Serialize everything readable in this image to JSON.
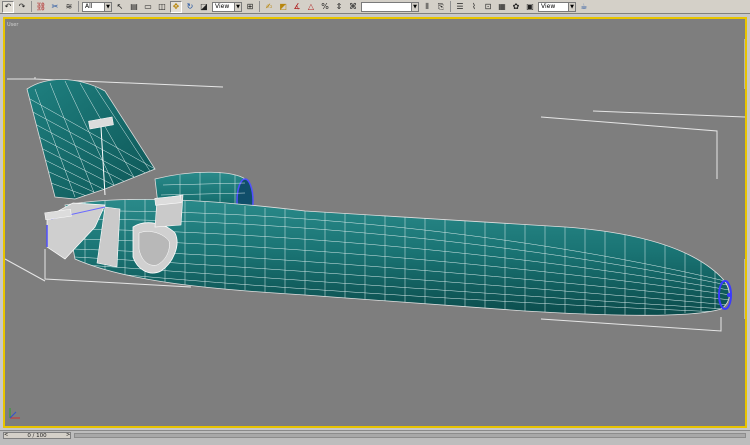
{
  "toolbar": {
    "selection_filter": "All",
    "reference_coord_1": "View",
    "reference_coord_2": "View",
    "named_selection": "",
    "icons": [
      "undo-icon",
      "redo-icon",
      "select-and-link-icon",
      "unlink-icon",
      "bind-spacewarp-icon",
      "select-object-icon",
      "select-by-name-icon",
      "rect-selection-icon",
      "window-crossing-icon",
      "select-move-icon",
      "select-rotate-icon",
      "select-scale-icon",
      "pivot-icon",
      "snap-toggle-icon",
      "angle-snap-icon",
      "percent-snap-icon",
      "spinner-snap-icon",
      "edit-named-sets-icon",
      "mirror-icon",
      "align-icon",
      "layer-manager-icon",
      "curve-editor-icon",
      "schematic-view-icon",
      "material-editor-icon",
      "render-setup-icon",
      "render-type-icon",
      "quick-render-icon"
    ]
  },
  "viewport": {
    "label": "User",
    "border_color": "#e8c400",
    "background": "#7e7e7e",
    "mesh_color": "#1a7474",
    "wire_color": "#ffffff",
    "selection_vertex_color": "#3a3aff"
  },
  "timebar": {
    "frame_readout": "0 / 100",
    "prev_label": "<",
    "next_label": ">"
  }
}
